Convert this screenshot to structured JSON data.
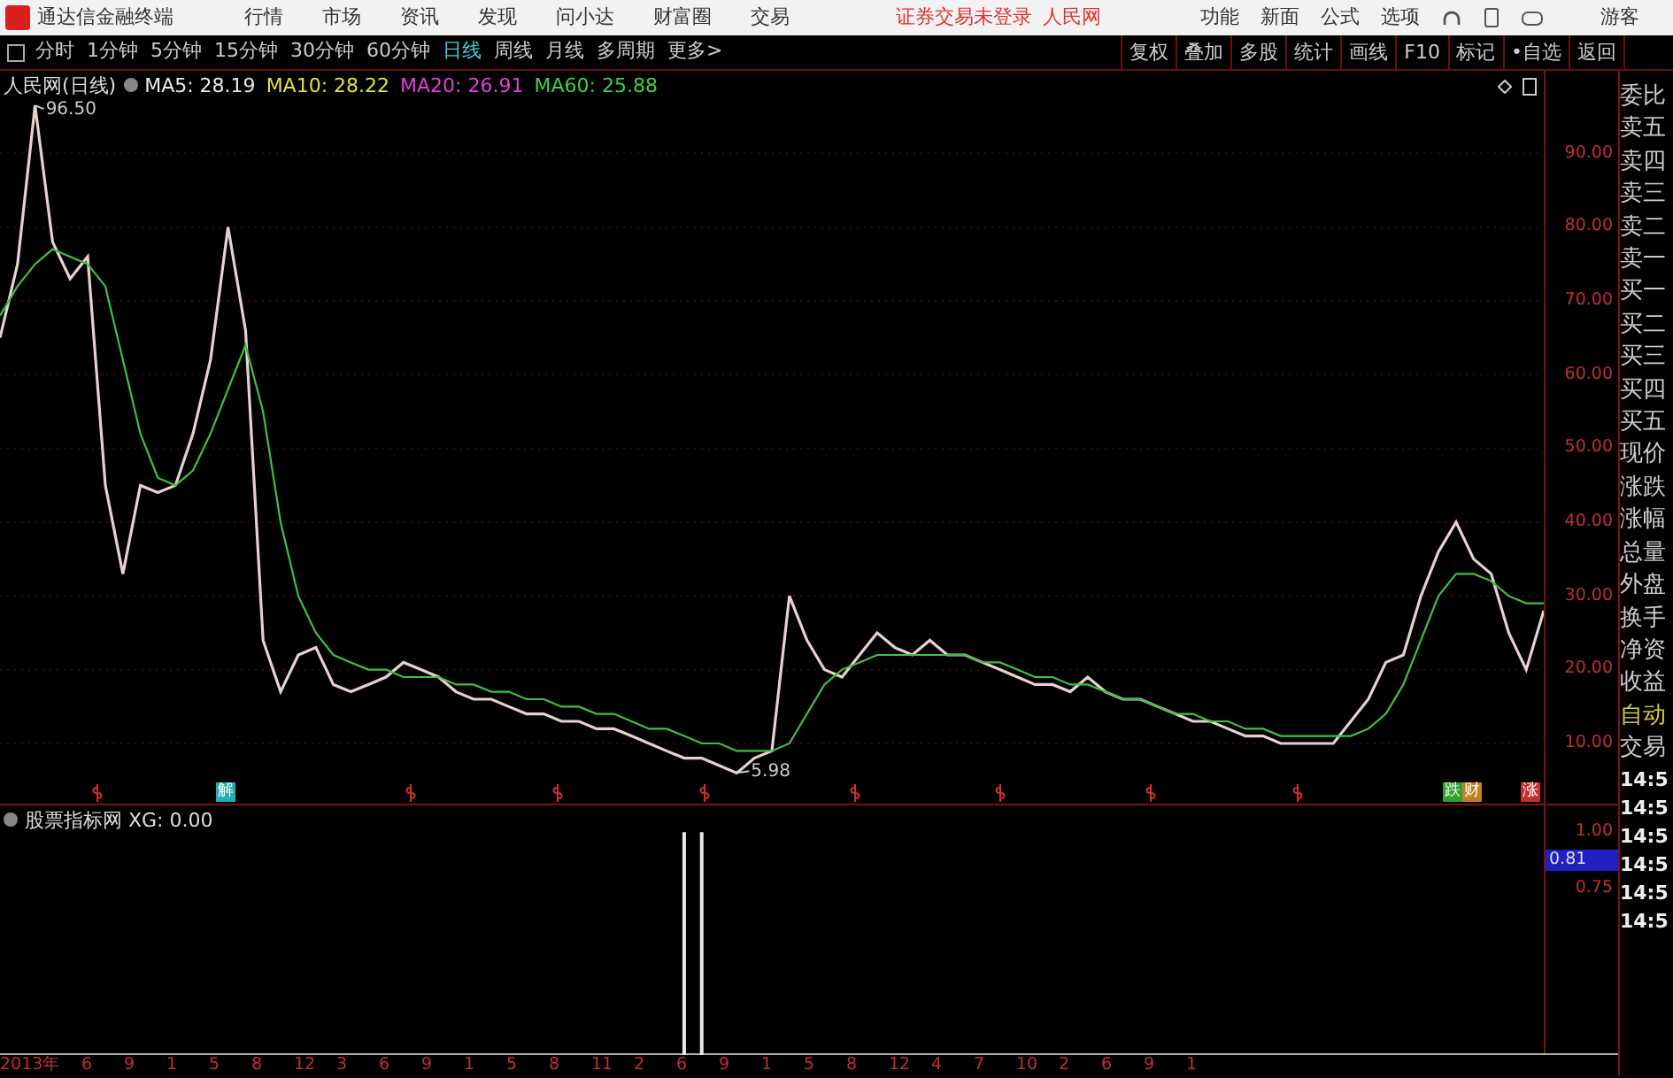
{
  "app": {
    "title": "通达信金融终端",
    "menus": [
      "行情",
      "市场",
      "资讯",
      "发现",
      "问小达",
      "财富圈",
      "交易"
    ],
    "login_notice": "证券交易未登录",
    "stock_name": "人民网",
    "tools": [
      "功能",
      "新面",
      "公式",
      "选项"
    ],
    "user": "游客"
  },
  "period_tabs": [
    {
      "label": "分时",
      "selected": false
    },
    {
      "label": "1分钟",
      "selected": false
    },
    {
      "label": "5分钟",
      "selected": false
    },
    {
      "label": "15分钟",
      "selected": false
    },
    {
      "label": "30分钟",
      "selected": false
    },
    {
      "label": "60分钟",
      "selected": false
    },
    {
      "label": "日线",
      "selected": true
    },
    {
      "label": "周线",
      "selected": false
    },
    {
      "label": "月线",
      "selected": false
    },
    {
      "label": "多周期",
      "selected": false
    },
    {
      "label": "更多>",
      "selected": false
    }
  ],
  "toolbar_buttons": [
    "复权",
    "叠加",
    "多股",
    "统计",
    "画线",
    "F10",
    "标记",
    "•自选",
    "返回"
  ],
  "price_chart": {
    "title": "人民网(日线)",
    "legend": [
      {
        "label": "MA5: 28.19",
        "color": "#e8e8e8"
      },
      {
        "label": "MA10: 28.22",
        "color": "#e0e040"
      },
      {
        "label": "MA20: 26.91",
        "color": "#e040e0"
      },
      {
        "label": "MA60: 25.88",
        "color": "#40d040"
      }
    ],
    "high_label": "96.50",
    "low_label": "5.98",
    "chart_data": {
      "type": "line",
      "grid": true,
      "ylim": [
        1.6,
        101.2
      ],
      "yticks": [
        {
          "value": 10,
          "label": "10.00"
        },
        {
          "value": 20,
          "label": "20.00"
        },
        {
          "value": 30,
          "label": "30.00"
        },
        {
          "value": 40,
          "label": "40.00"
        },
        {
          "value": 50,
          "label": "50.00"
        },
        {
          "value": 60,
          "label": "60.00"
        },
        {
          "value": 70,
          "label": "70.00"
        },
        {
          "value": 80,
          "label": "80.00"
        },
        {
          "value": 90,
          "label": "90.00"
        }
      ],
      "categories": [
        null,
        null,
        null,
        null,
        null,
        null,
        null,
        null,
        null,
        null,
        null,
        null,
        null,
        null,
        null,
        null,
        null,
        null,
        null,
        null,
        null,
        null,
        null,
        null,
        null,
        null,
        null,
        null,
        null,
        null,
        null,
        null,
        null,
        null,
        null,
        null,
        null,
        null,
        null,
        null,
        null,
        null,
        null,
        null,
        null,
        null,
        null,
        null,
        null,
        null,
        null,
        null,
        null,
        null,
        null,
        null,
        null,
        null,
        null,
        null,
        null,
        null,
        null,
        null,
        null,
        null,
        null,
        null,
        null,
        null,
        null,
        null,
        null,
        null,
        null,
        null,
        null,
        null,
        null,
        null,
        null,
        null,
        null,
        null,
        null,
        null,
        null,
        null,
        null
      ],
      "series": [
        {
          "color": "#e8d0d0",
          "values": [
            65,
            75,
            96.5,
            78,
            73,
            76,
            45,
            33,
            45,
            44,
            45,
            52,
            62,
            80,
            66,
            24,
            17,
            22,
            23,
            18,
            17,
            18,
            19,
            21,
            20,
            19,
            17,
            16,
            16,
            15,
            14,
            14,
            13,
            13,
            12,
            12,
            11,
            10,
            9,
            8,
            8,
            7,
            6,
            8,
            9,
            30,
            24,
            20,
            19,
            22,
            25,
            23,
            22,
            24,
            22,
            22,
            21,
            20,
            19,
            18,
            18,
            17,
            19,
            17,
            16,
            16,
            15,
            14,
            13,
            13,
            12,
            11,
            11,
            10,
            10,
            10,
            10,
            13,
            16,
            21,
            22,
            30,
            36,
            40,
            35,
            33,
            25,
            20,
            28
          ]
        },
        {
          "color": "#40c040",
          "values": [
            68,
            72,
            75,
            77,
            76,
            75,
            72,
            62,
            52,
            46,
            45,
            47,
            52,
            58,
            64,
            55,
            40,
            30,
            25,
            22,
            21,
            20,
            20,
            19,
            19,
            19,
            18,
            18,
            17,
            17,
            16,
            16,
            15,
            15,
            14,
            14,
            13,
            12,
            12,
            11,
            10,
            10,
            9,
            9,
            9,
            10,
            14,
            18,
            20,
            21,
            22,
            22,
            22,
            22,
            22,
            22,
            21,
            21,
            20,
            19,
            19,
            18,
            18,
            17,
            16,
            16,
            15,
            14,
            14,
            13,
            13,
            12,
            12,
            11,
            11,
            11,
            11,
            11,
            12,
            14,
            18,
            24,
            30,
            33,
            33,
            32,
            30,
            29,
            29
          ]
        }
      ]
    },
    "event_tags": [
      {
        "label": "解",
        "color": "#20b0b0"
      },
      {
        "label": "跌",
        "color": "#30a030"
      },
      {
        "label": "财",
        "color": "#c08020"
      },
      {
        "label": "涨",
        "color": "#c03030"
      }
    ]
  },
  "indicator_panel": {
    "title": "股票指标网 XG: 0.00",
    "cursor_value": "0.81",
    "chart_data": {
      "type": "bar",
      "ylim": [
        0,
        1.12
      ],
      "yticks": [
        {
          "value": 0.75,
          "label": "0.75"
        },
        {
          "value": 1,
          "label": "1.00"
        }
      ],
      "categories": [
        null,
        null,
        null,
        null,
        null,
        null,
        null,
        null,
        null,
        null,
        null,
        null,
        null,
        null,
        null,
        null,
        null,
        null,
        null,
        null,
        null,
        null,
        null,
        null,
        null,
        null,
        null,
        null,
        null,
        null,
        null,
        null,
        null,
        null,
        null,
        null,
        null,
        null,
        null,
        null,
        null,
        null,
        null,
        null,
        null,
        null,
        null,
        null,
        null,
        null,
        null,
        null,
        null,
        null,
        null,
        null,
        null,
        null,
        null,
        null,
        null,
        null,
        null,
        null,
        null,
        null,
        null,
        null,
        null,
        null,
        null,
        null,
        null,
        null,
        null,
        null,
        null,
        null,
        null,
        null,
        null,
        null,
        null,
        null,
        null,
        null,
        null,
        null,
        null
      ],
      "values": [
        null,
        null,
        null,
        null,
        null,
        null,
        null,
        null,
        null,
        null,
        null,
        null,
        null,
        null,
        null,
        null,
        null,
        null,
        null,
        null,
        null,
        null,
        null,
        null,
        null,
        null,
        null,
        null,
        null,
        null,
        null,
        null,
        null,
        null,
        null,
        null,
        null,
        null,
        null,
        1,
        1,
        null,
        null,
        null,
        null,
        null,
        null,
        null,
        null,
        null,
        null,
        null,
        null,
        null,
        null,
        null,
        null,
        null,
        null,
        null,
        null,
        null,
        null,
        null,
        null,
        null,
        null,
        null,
        null,
        null,
        null,
        null,
        null,
        null,
        null,
        null,
        null,
        null,
        null,
        null,
        null,
        null,
        null,
        null,
        null,
        null,
        null,
        null,
        null
      ]
    }
  },
  "time_axis": [
    "2013年",
    "6",
    "9",
    "1",
    "5",
    "8",
    "12",
    "3",
    "6",
    "9",
    "1",
    "5",
    "8",
    "11",
    "2",
    "6",
    "9",
    "1",
    "5",
    "8",
    "12",
    "4",
    "7",
    "10",
    "2",
    "6",
    "9",
    "1"
  ],
  "quote_fields": [
    {
      "label": "委比",
      "active": false
    },
    {
      "label": "卖五",
      "active": false
    },
    {
      "label": "卖四",
      "active": false
    },
    {
      "label": "卖三",
      "active": false
    },
    {
      "label": "卖二",
      "active": false
    },
    {
      "label": "卖一",
      "active": false
    },
    {
      "label": "买一",
      "active": false
    },
    {
      "label": "买二",
      "active": false
    },
    {
      "label": "买三",
      "active": false
    },
    {
      "label": "买四",
      "active": false
    },
    {
      "label": "买五",
      "active": false
    },
    {
      "label": "现价",
      "active": false
    },
    {
      "label": "涨跌",
      "active": false
    },
    {
      "label": "涨幅",
      "active": false
    },
    {
      "label": "总量",
      "active": false
    },
    {
      "label": "外盘",
      "active": false
    },
    {
      "label": "换手",
      "active": false
    },
    {
      "label": "净资",
      "active": false
    },
    {
      "label": "收益",
      "active": false
    },
    {
      "label": "自动",
      "active": true
    },
    {
      "label": "交易",
      "active": false
    }
  ],
  "trade_times": [
    "14:5",
    "14:5",
    "14:5",
    "14:5",
    "14:5",
    "14:5"
  ]
}
